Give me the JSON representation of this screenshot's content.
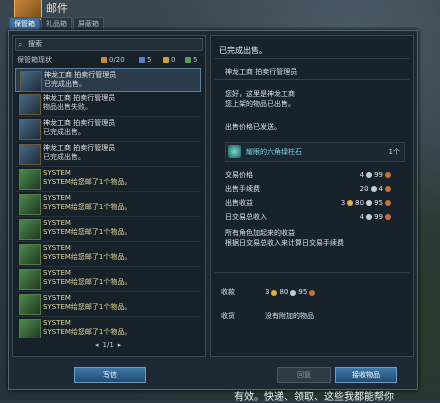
{
  "window": {
    "title": "邮件"
  },
  "tabs": [
    {
      "label": "保管箱"
    },
    {
      "label": "礼品箱"
    },
    {
      "label": "屏蔽箱"
    }
  ],
  "search": {
    "placeholder": "搜索"
  },
  "status": {
    "label": "保管箱现状",
    "count1": "0/20",
    "count2": "5",
    "count3": "0",
    "count4": "5"
  },
  "list": {
    "items": [
      {
        "line1": "神龙工商 拍卖行管理员",
        "line2": "已完成出售。",
        "type": "auction",
        "selected": true
      },
      {
        "line1": "神龙工商 拍卖行管理员",
        "line2": "物品出售失败。",
        "type": "auction"
      },
      {
        "line1": "神龙工商 拍卖行管理员",
        "line2": "已完成出售。",
        "type": "auction"
      },
      {
        "line1": "神龙工商 拍卖行管理员",
        "line2": "已完成出售。",
        "type": "auction"
      },
      {
        "line1": "SYSTEM",
        "line2": "SYSTEM给您邮了1个物品。",
        "type": "sys"
      },
      {
        "line1": "SYSTEM",
        "line2": "SYSTEM给您邮了1个物品。",
        "type": "sys"
      },
      {
        "line1": "SYSTEM",
        "line2": "SYSTEM给您邮了1个物品。",
        "type": "sys"
      },
      {
        "line1": "SYSTEM",
        "line2": "SYSTEM给您邮了1个物品。",
        "type": "sys"
      },
      {
        "line1": "SYSTEM",
        "line2": "SYSTEM给您邮了1个物品。",
        "type": "sys"
      },
      {
        "line1": "SYSTEM",
        "line2": "SYSTEM给您邮了1个物品。",
        "type": "sys"
      },
      {
        "line1": "SYSTEM",
        "line2": "SYSTEM给您邮了1个物品。",
        "type": "sys"
      }
    ]
  },
  "pager": {
    "text": "1/1"
  },
  "buttons": {
    "write": "写信",
    "back": "回复",
    "collect": "接收物品"
  },
  "detail": {
    "subject": "已完成出售。",
    "sender": "神龙工商 拍卖行管理员",
    "body1": "您好，这里是神龙工商",
    "body2": "您上架的物品已出售。",
    "body3": "出售价格已发送。",
    "item_name": "耀眼的六角绿柱石",
    "item_qty": "1个",
    "rows": [
      {
        "label": "交易价格",
        "gold": "",
        "silver": "4",
        "copper": "99"
      },
      {
        "label": "出售手续费",
        "gold": "",
        "silver": "20",
        "copper": "4"
      },
      {
        "label": "出售收益",
        "gold": "3",
        "silver": "80",
        "copper": "95"
      },
      {
        "label": "日交易总收入",
        "gold": "",
        "silver": "4",
        "copper": "99"
      }
    ],
    "note1": "所有角色加起来的收益",
    "note2": "根据日交易总收入来计算日交易手续费",
    "money_label": "收款",
    "money_gold": "3",
    "money_silver": "80",
    "money_copper": "95",
    "attach_label": "收货",
    "attach_value": "没有附加的物品"
  },
  "footer": {
    "text": "有效。快递、领取、这些我都能帮你"
  }
}
